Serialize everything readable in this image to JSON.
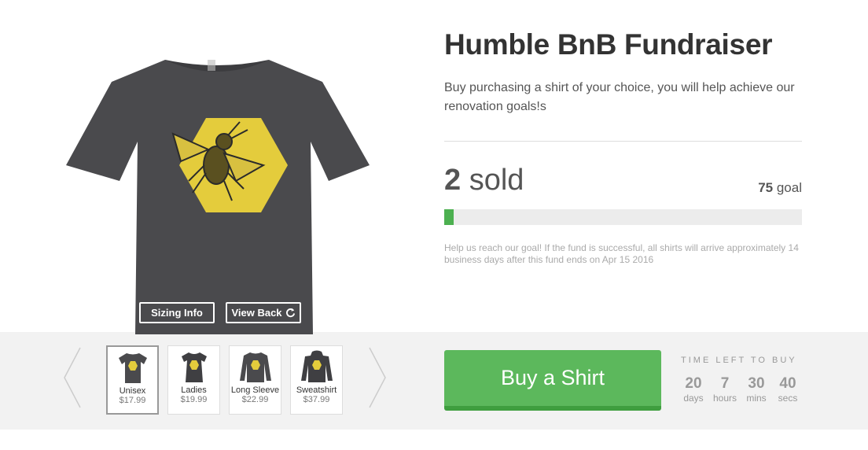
{
  "campaign": {
    "title": "Humble BnB Fundraiser",
    "description": "Buy purchasing a shirt of your choice, you will help achieve our renovation goals!s",
    "sold_count": "2",
    "sold_label": " sold",
    "goal_count": "75",
    "goal_label": " goal",
    "progress_fraction": 0.027,
    "help_text": "Help us reach our goal! If the fund is successful, all shirts will arrive approximately 14 business days after this fund ends on Apr 15 2016"
  },
  "shirt_buttons": {
    "sizing": "Sizing Info",
    "view_back": "View Back",
    "view_back_icon": "refresh-icon"
  },
  "products": [
    {
      "name": "Unisex",
      "price": "$17.99",
      "selected": true,
      "style": "tshirt"
    },
    {
      "name": "Ladies",
      "price": "$19.99",
      "selected": false,
      "style": "ladies"
    },
    {
      "name": "Long Sleeve",
      "price": "$22.99",
      "selected": false,
      "style": "longsleeve"
    },
    {
      "name": "Sweatshirt",
      "price": "$37.99",
      "selected": false,
      "style": "hoodie"
    }
  ],
  "buy_button": "Buy a Shirt",
  "timer": {
    "label": "TIME LEFT TO BUY",
    "days": "20",
    "days_label": "days",
    "hours": "7",
    "hours_label": "hours",
    "mins": "30",
    "mins_label": "mins",
    "secs": "40",
    "secs_label": "secs"
  },
  "colors": {
    "shirt": "#4a4a4d",
    "print": "#e4cc3c",
    "accent_green": "#5cb85c",
    "progress_green": "#4cb050"
  }
}
